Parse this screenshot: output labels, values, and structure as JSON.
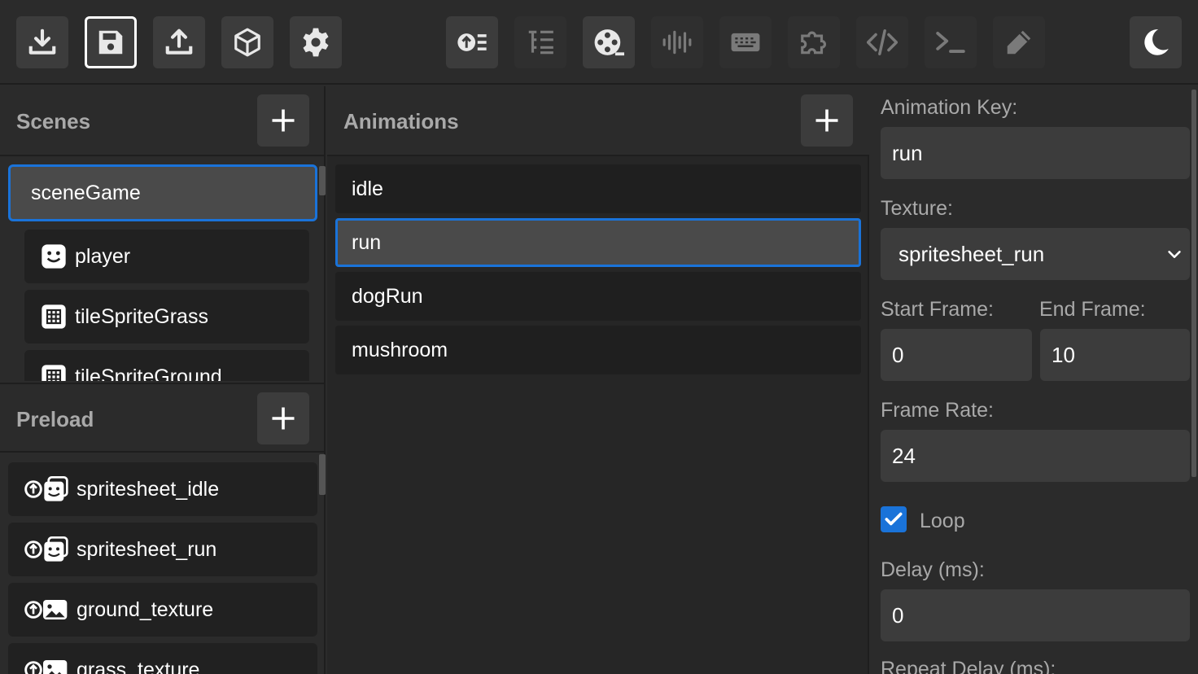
{
  "toolbar": {
    "left_buttons": [
      "download-icon",
      "save-icon",
      "upload-icon",
      "cube-icon",
      "gear-icon"
    ],
    "center_buttons": [
      "upload-list-icon",
      "tree-list-icon",
      "film-reel-icon",
      "audio-wave-icon",
      "keyboard-icon",
      "puzzle-icon",
      "code-icon",
      "terminal-icon",
      "pencil-icon"
    ],
    "right_button": "moon-icon",
    "active_button": "save-icon"
  },
  "scenes": {
    "title": "Scenes",
    "selected": "sceneGame",
    "children": [
      {
        "label": "player",
        "icon": "smiley-icon"
      },
      {
        "label": "tileSpriteGrass",
        "icon": "grid-icon"
      },
      {
        "label": "tileSpriteGround",
        "icon": "grid-icon"
      }
    ]
  },
  "preload": {
    "title": "Preload",
    "items": [
      {
        "label": "spritesheet_idle",
        "icon": "upload-spritesheet-icon"
      },
      {
        "label": "spritesheet_run",
        "icon": "upload-spritesheet-icon"
      },
      {
        "label": "ground_texture",
        "icon": "upload-image-icon"
      },
      {
        "label": "grass_texture",
        "icon": "upload-image-icon"
      }
    ]
  },
  "animations": {
    "title": "Animations",
    "items": [
      "idle",
      "run",
      "dogRun",
      "mushroom"
    ],
    "selected": "run"
  },
  "properties": {
    "animation_key_label": "Animation Key:",
    "animation_key_value": "run",
    "texture_label": "Texture:",
    "texture_value": "spritesheet_run",
    "start_frame_label": "Start Frame:",
    "start_frame_value": "0",
    "end_frame_label": "End Frame:",
    "end_frame_value": "10",
    "frame_rate_label": "Frame Rate:",
    "frame_rate_value": "24",
    "loop_label": "Loop",
    "loop_checked": true,
    "delay_label": "Delay (ms):",
    "delay_value": "0",
    "repeat_delay_label": "Repeat Delay (ms):"
  },
  "colors": {
    "accent": "#1a73d9",
    "panel": "#2b2b2b",
    "item": "#212121",
    "field": "#3c3c3c"
  }
}
